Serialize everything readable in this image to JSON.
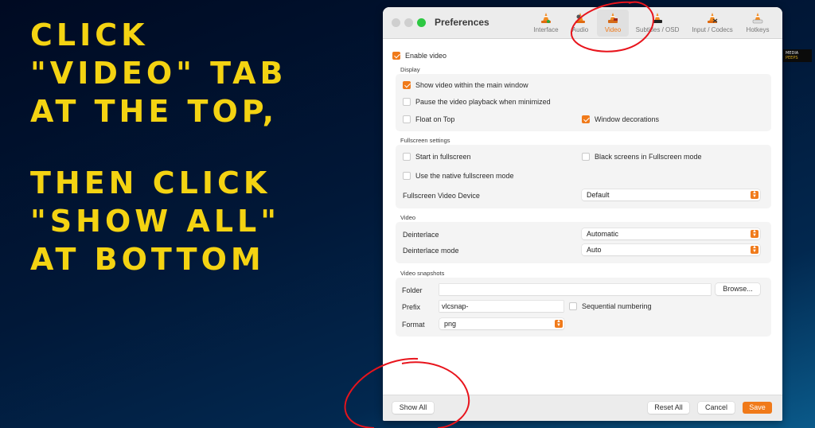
{
  "instructions": {
    "block1": [
      "CLICK",
      "\"VIDEO\" TAB",
      "AT THE TOP,"
    ],
    "block2": [
      "THEN CLICK",
      "\"SHOW ALL\"",
      "AT BOTTOM"
    ]
  },
  "logo": {
    "line1": "MEDIA",
    "line2": "PEEPS"
  },
  "window": {
    "title": "Preferences",
    "tabs": [
      {
        "label": "Interface",
        "icon": "vlc-cone-interface-icon",
        "active": false
      },
      {
        "label": "Audio",
        "icon": "vlc-cone-audio-icon",
        "active": false
      },
      {
        "label": "Video",
        "icon": "vlc-cone-video-icon",
        "active": true
      },
      {
        "label": "Subtitles / OSD",
        "icon": "vlc-cone-subtitles-icon",
        "active": false
      },
      {
        "label": "Input / Codecs",
        "icon": "vlc-cone-input-icon",
        "active": false
      },
      {
        "label": "Hotkeys",
        "icon": "vlc-cone-hotkeys-icon",
        "active": false
      }
    ]
  },
  "video": {
    "enable_video": {
      "label": "Enable video",
      "checked": true
    },
    "display": {
      "title": "Display",
      "show_in_main": {
        "label": "Show video within the main window",
        "checked": true
      },
      "pause_minimized": {
        "label": "Pause the video playback when minimized",
        "checked": false
      },
      "float_on_top": {
        "label": "Float on Top",
        "checked": false
      },
      "window_decorations": {
        "label": "Window decorations",
        "checked": true
      }
    },
    "fullscreen": {
      "title": "Fullscreen settings",
      "start_fullscreen": {
        "label": "Start in fullscreen",
        "checked": false
      },
      "black_screens": {
        "label": "Black screens in Fullscreen mode",
        "checked": false
      },
      "native_mode": {
        "label": "Use the native fullscreen mode",
        "checked": false
      },
      "device_label": "Fullscreen Video Device",
      "device_value": "Default"
    },
    "video_group": {
      "title": "Video",
      "deinterlace_label": "Deinterlace",
      "deinterlace_value": "Automatic",
      "deinterlace_mode_label": "Deinterlace mode",
      "deinterlace_mode_value": "Auto"
    },
    "snapshots": {
      "title": "Video snapshots",
      "folder_label": "Folder",
      "folder_value": "",
      "browse_label": "Browse...",
      "prefix_label": "Prefix",
      "prefix_value": "vlcsnap-",
      "sequential": {
        "label": "Sequential numbering",
        "checked": false
      },
      "format_label": "Format",
      "format_value": "png"
    }
  },
  "footer": {
    "show_all": "Show All",
    "reset_all": "Reset All",
    "cancel": "Cancel",
    "save": "Save"
  },
  "colors": {
    "accent": "#f07a1a",
    "instruction_text": "#f4d312",
    "annotation": "#e8141c"
  }
}
